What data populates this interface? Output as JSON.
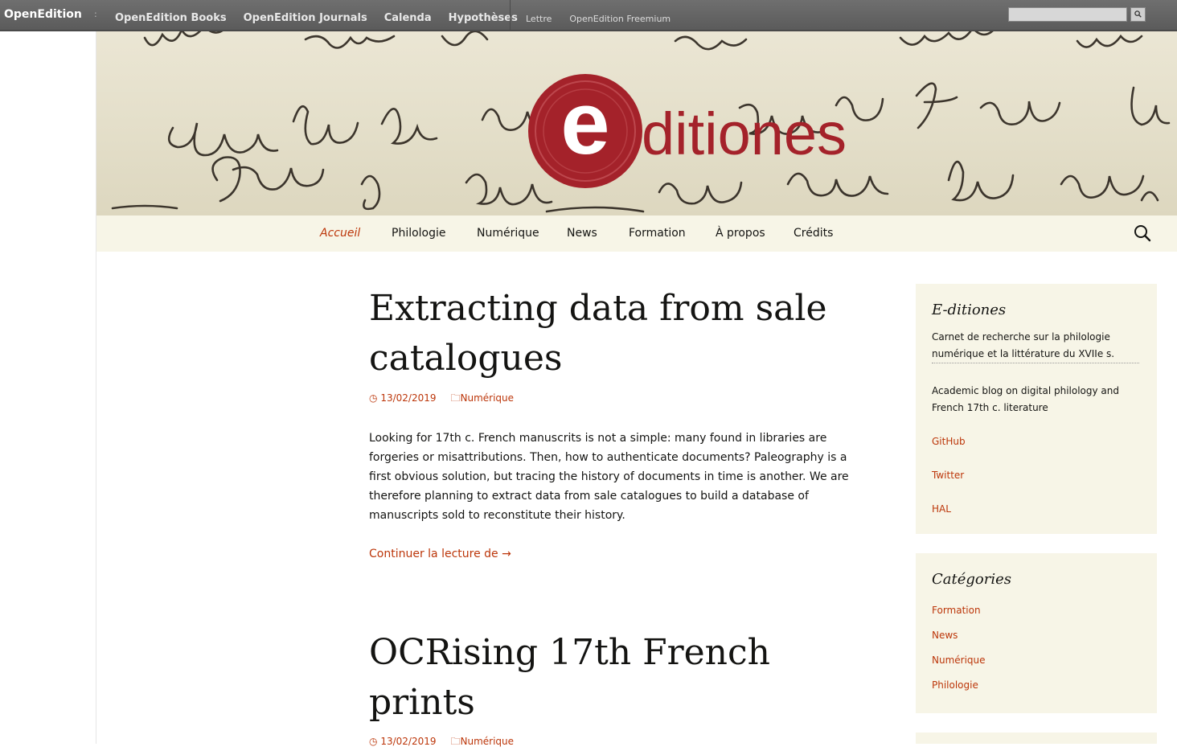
{
  "topbar": {
    "brand": "OpenEdition",
    "separator": ":",
    "main_links": [
      "OpenEdition Books",
      "OpenEdition Journals",
      "Calenda",
      "Hypothèses"
    ],
    "sub_links": [
      "Lettre",
      "OpenEdition Freemium"
    ],
    "search_button": "🔍"
  },
  "banner": {
    "logo_letter": "e",
    "logo_text": "ditiones"
  },
  "nav": {
    "items": [
      "Accueil",
      "Philologie",
      "Numérique",
      "News",
      "Formation",
      "À propos",
      "Crédits"
    ],
    "active": "Accueil"
  },
  "posts": [
    {
      "title": "Extracting data from sale catalogues",
      "date": "13/02/2019",
      "category": "Numérique",
      "excerpt": "Looking for 17th c. French manuscrits is not a simple: many found in libraries are forgeries or misattributions. Then, how to authenticate documents? Paleography is a first obvious solution, but tracing the history of documents in time is another. We are therefore planning to extract data from sale catalogues to build a database of manuscripts sold to reconstitute their history.",
      "more": "Continuer la lecture de →"
    },
    {
      "title": "OCRising 17th French prints",
      "date": "13/02/2019",
      "category": "Numérique"
    }
  ],
  "sidebar": {
    "about": {
      "title": "E-ditiones",
      "text_fr": "Carnet de recherche sur la philologie numérique et la littérature du XVIIe s.",
      "text_en": "Academic blog on digital philology and French 17th c. literature",
      "links": [
        "GitHub",
        "Twitter",
        "HAL"
      ]
    },
    "categories": {
      "title": "Catégories",
      "items": [
        "Formation",
        "News",
        "Numérique",
        "Philologie"
      ]
    }
  },
  "colors": {
    "accent": "#bc360a",
    "logo_red": "#a4222a",
    "nav_bg": "#f7f5e7"
  }
}
